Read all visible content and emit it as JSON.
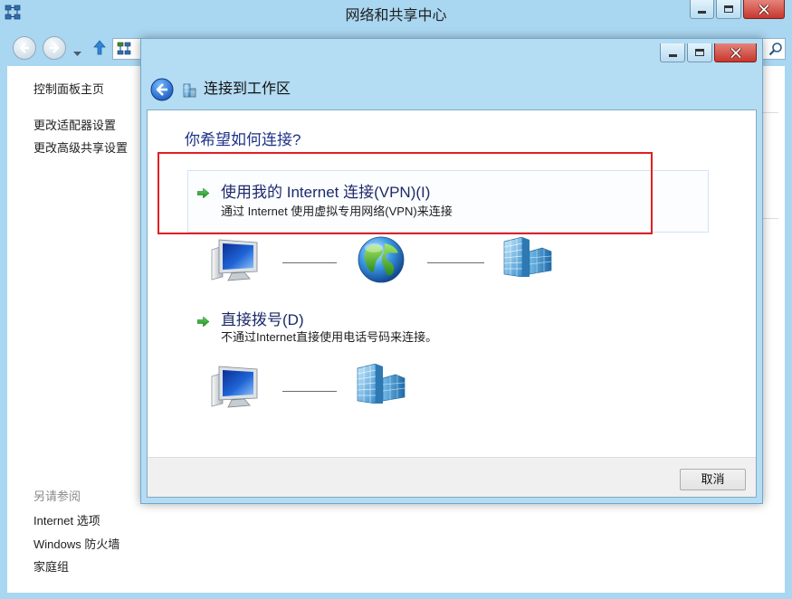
{
  "window": {
    "title": "网络和共享中心",
    "icons": [
      "network-center-icon",
      "minimize-icon",
      "maximize-icon",
      "close-icon"
    ]
  },
  "navigation": {
    "icons": [
      "back-arrow-icon",
      "forward-arrow-icon",
      "chevron-down-icon",
      "up-arrow-icon",
      "network-icon",
      "search-icon"
    ]
  },
  "sidebar": {
    "links": [
      {
        "label": "控制面板主页"
      },
      {
        "label": "更改适配器设置"
      },
      {
        "label": "更改高级共享设置"
      }
    ],
    "see_also": {
      "heading": "另请参阅",
      "links": [
        {
          "label": "Internet 选项"
        },
        {
          "label": "Windows 防火墙"
        },
        {
          "label": "家庭组"
        }
      ]
    }
  },
  "dialog": {
    "title": "连接到工作区",
    "icons": [
      "back-button-icon",
      "workplace-icon",
      "minimize-icon",
      "maximize-icon",
      "close-icon"
    ],
    "question": "你希望如何连接?",
    "options": [
      {
        "title": "使用我的 Internet 连接(VPN)(I)",
        "description": "通过 Internet 使用虚拟专用网络(VPN)来连接",
        "highlighted": true,
        "diagram": [
          "computer-icon",
          "globe-icon",
          "building-icon"
        ]
      },
      {
        "title": "直接拨号(D)",
        "description": "不通过Internet直接使用电话号码来连接。",
        "highlighted": false,
        "diagram": [
          "computer-icon",
          "building-icon"
        ]
      }
    ],
    "cancel_label": "取消"
  },
  "colors": {
    "frame": "#a9d6f0",
    "dialog_frame": "#b4dcf3",
    "close_button": "#c7372f",
    "instruction_text": "#1e3287",
    "option_title": "#1c2a6a",
    "annotation_outline": "#e31e24",
    "footer": "#f0f0f0"
  }
}
